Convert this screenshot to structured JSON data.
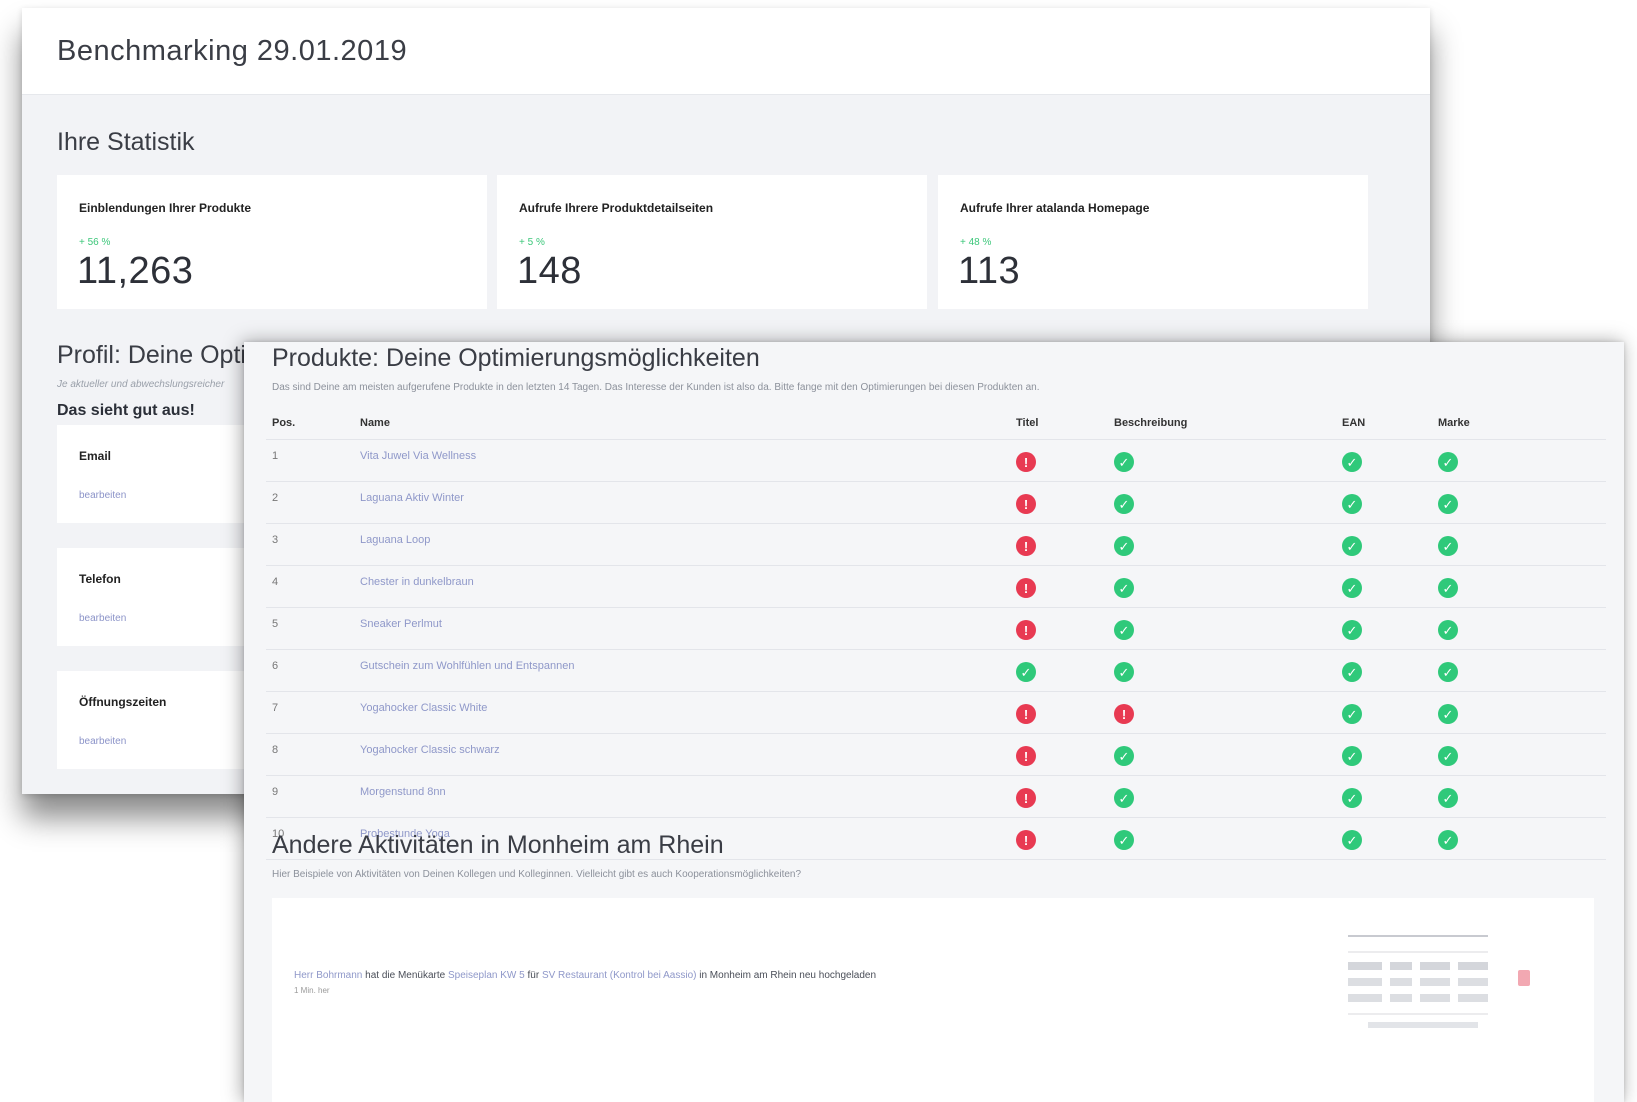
{
  "dashboard": {
    "title": "Benchmarking 29.01.2019",
    "stats_heading": "Ihre Statistik",
    "stats": [
      {
        "label": "Einblendungen Ihrer Produkte",
        "delta": "+ 56 %",
        "value": "11,263"
      },
      {
        "label": "Aufrufe Ihrere Produktdetailseiten",
        "delta": "+ 5 %",
        "value": "148"
      },
      {
        "label": "Aufrufe Ihrer atalanda Homepage",
        "delta": "+ 48 %",
        "value": "113"
      }
    ],
    "profile": {
      "heading": "Profil: Deine Optimierungsmöglichkeiten",
      "note": "Je aktueller und abwechslungsreicher",
      "status": "Das sieht gut aus!",
      "cards": [
        {
          "label": "Email",
          "link": "bearbeiten"
        },
        {
          "label": "Telefon",
          "link": "bearbeiten"
        },
        {
          "label": "Öffnungszeiten",
          "link": "bearbeiten"
        }
      ]
    }
  },
  "products": {
    "heading": "Produkte: Deine Optimierungsmöglichkeiten",
    "description": "Das sind Deine am meisten aufgerufene Produkte in den letzten 14 Tagen. Das Interesse der Kunden ist also da. Bitte fange mit den Optimierungen bei diesen Produkten an.",
    "columns": {
      "pos": "Pos.",
      "name": "Name",
      "titel": "Titel",
      "beschreibung": "Beschreibung",
      "ean": "EAN",
      "marke": "Marke"
    },
    "rows": [
      {
        "pos": "1",
        "name": "Vita Juwel Via Wellness",
        "titel": false,
        "beschreibung": true,
        "ean": true,
        "marke": true
      },
      {
        "pos": "2",
        "name": "Laguana Aktiv Winter",
        "titel": false,
        "beschreibung": true,
        "ean": true,
        "marke": true
      },
      {
        "pos": "3",
        "name": "Laguana Loop",
        "titel": false,
        "beschreibung": true,
        "ean": true,
        "marke": true
      },
      {
        "pos": "4",
        "name": "Chester in dunkelbraun",
        "titel": false,
        "beschreibung": true,
        "ean": true,
        "marke": true
      },
      {
        "pos": "5",
        "name": "Sneaker Perlmut",
        "titel": false,
        "beschreibung": true,
        "ean": true,
        "marke": true
      },
      {
        "pos": "6",
        "name": "Gutschein zum Wohlfühlen und Entspannen",
        "titel": true,
        "beschreibung": true,
        "ean": true,
        "marke": true
      },
      {
        "pos": "7",
        "name": "Yogahocker Classic White",
        "titel": false,
        "beschreibung": false,
        "ean": true,
        "marke": true
      },
      {
        "pos": "8",
        "name": "Yogahocker Classic schwarz",
        "titel": false,
        "beschreibung": true,
        "ean": true,
        "marke": true
      },
      {
        "pos": "9",
        "name": "Morgenstund 8nn",
        "titel": false,
        "beschreibung": true,
        "ean": true,
        "marke": true
      },
      {
        "pos": "10",
        "name": "Probestunde Yoga",
        "titel": false,
        "beschreibung": true,
        "ean": true,
        "marke": true
      }
    ],
    "icons": {
      "ok": "check-circle-icon",
      "bad": "exclamation-circle-icon"
    },
    "colors": {
      "ok": "#2fc97a",
      "bad": "#e83a52",
      "link": "#8f98c9"
    }
  },
  "activities": {
    "heading": "Andere Aktivitäten in Monheim am Rhein",
    "description": "Hier Beispiele von Aktivitäten von Deinen Kollegen und Kolleginnen. Vielleicht gibt es auch Kooperationsmöglichkeiten?",
    "item": {
      "actor": "Herr Bohrmann",
      "text_1": "hat die Menükarte",
      "menu": "Speiseplan KW 5",
      "text_2": "für",
      "place": "SV Restaurant (Kontrol bei Aassio)",
      "text_3": "in Monheim am Rhein neu hochgeladen",
      "time": "1 Min. her"
    }
  }
}
